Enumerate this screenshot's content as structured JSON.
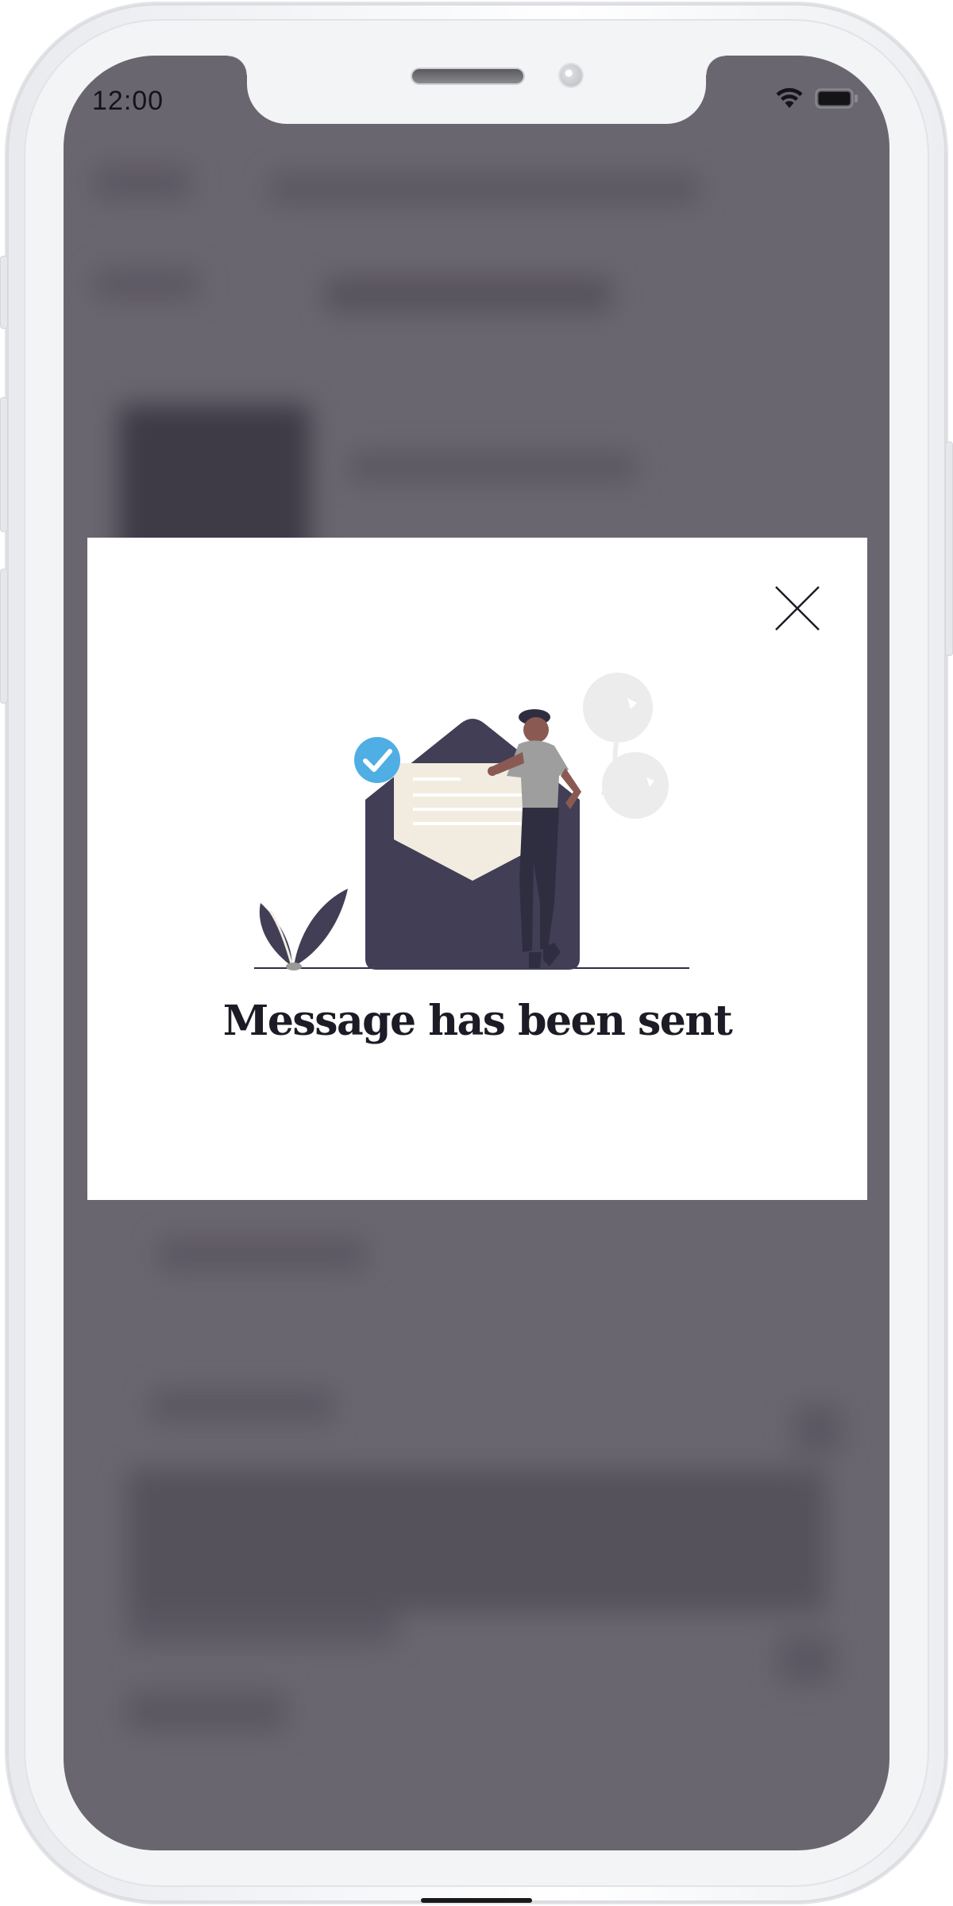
{
  "status_bar": {
    "time": "12:00",
    "wifi_icon": "wifi-icon",
    "battery_icon": "battery-icon"
  },
  "modal": {
    "title": "Message has been sent",
    "close_icon": "close-icon",
    "illustration": "message-sent-illustration"
  },
  "colors": {
    "overlay": "#6a6670",
    "modal_background": "#ffffff",
    "title_text": "#1d1b26",
    "envelope": "#413e56",
    "letter": "#f2ece0",
    "check_badge": "#4faee3"
  }
}
